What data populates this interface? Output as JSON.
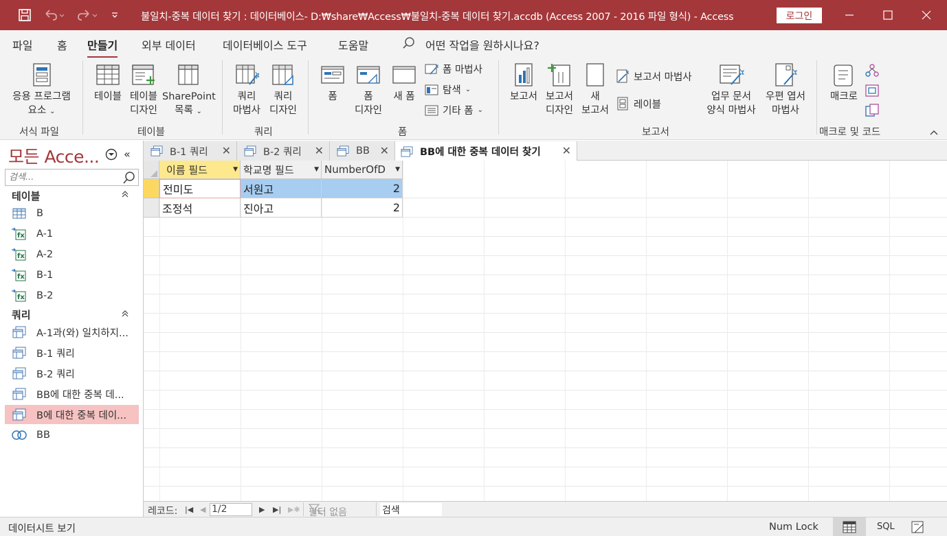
{
  "titlebar": {
    "title": "불일치-중복 데이터 찾기 : 데이터베이스- D:₩share₩Access₩불일치-중복 데이터 찾기.accdb (Access 2007 - 2016 파일 형식)  -  Access",
    "login_label": "로그인"
  },
  "ribbon_tabs": {
    "file": "파일",
    "home": "홈",
    "create": "만들기",
    "external": "외부 데이터",
    "dbtools": "데이터베이스 도구",
    "help": "도움말",
    "tellme": "어떤 작업을 원하시나요?"
  },
  "ribbon": {
    "app_parts_line1": "응용 프로그램",
    "app_parts_line2": "요소",
    "table": "테이블",
    "table_design_line1": "테이블",
    "table_design_line2": "디자인",
    "sharepoint_line1": "SharePoint",
    "sharepoint_line2": "목록",
    "query_wizard_line1": "쿼리",
    "query_wizard_line2": "마법사",
    "query_design_line1": "쿼리",
    "query_design_line2": "디자인",
    "form": "폼",
    "form_design_line1": "폼",
    "form_design_line2": "디자인",
    "blank_form": "새 폼",
    "form_wizard": "폼 마법사",
    "navigation": "탐색",
    "more_forms": "기타 폼",
    "report": "보고서",
    "report_design_line1": "보고서",
    "report_design_line2": "디자인",
    "blank_report_line1": "새",
    "blank_report_line2": "보고서",
    "report_wizard": "보고서 마법사",
    "labels": "레이블",
    "biz_doc_line1": "업무 문서",
    "biz_doc_line2": "양식 마법사",
    "postcard_line1": "우편 엽서",
    "postcard_line2": "마법사",
    "macro": "매크로",
    "groups": {
      "templates": "서식 파일",
      "tables": "테이블",
      "queries": "쿼리",
      "forms": "폼",
      "reports": "보고서",
      "macros": "매크로 및 코드"
    }
  },
  "nav": {
    "title": "모든 Acce...",
    "search_placeholder": "검색...",
    "tables_header": "테이블",
    "tables": [
      "B",
      "A-1",
      "A-2",
      "B-1",
      "B-2"
    ],
    "queries_header": "쿼리",
    "queries": [
      "A-1과(와) 일치하지...",
      "B-1 쿼리",
      "B-2 쿼리",
      "BB에 대한 중복 데...",
      "B에 대한 중복 데이...",
      "BB"
    ]
  },
  "doc_tabs": [
    "B-1 쿼리",
    "B-2 쿼리",
    "BB",
    "BB에 대한 중복 데이터 찾기"
  ],
  "datasheet": {
    "columns": [
      "이름 필드",
      "학교명 필드",
      "NumberOfD"
    ],
    "rows": [
      [
        "전미도",
        "서원고",
        "2"
      ],
      [
        "조정석",
        "진아고",
        "2"
      ]
    ]
  },
  "record_nav": {
    "label": "레코드:",
    "position": "1/2",
    "filter": "필터 없음",
    "search": "검색"
  },
  "status": {
    "view": "데이터시트 보기",
    "numlock": "Num Lock",
    "sql": "SQL"
  },
  "colors": {
    "accent": "#a4373a",
    "selected_row": "#a7cdf0",
    "nav_selected": "#f6c2c2",
    "header_active": "#fde88e"
  }
}
